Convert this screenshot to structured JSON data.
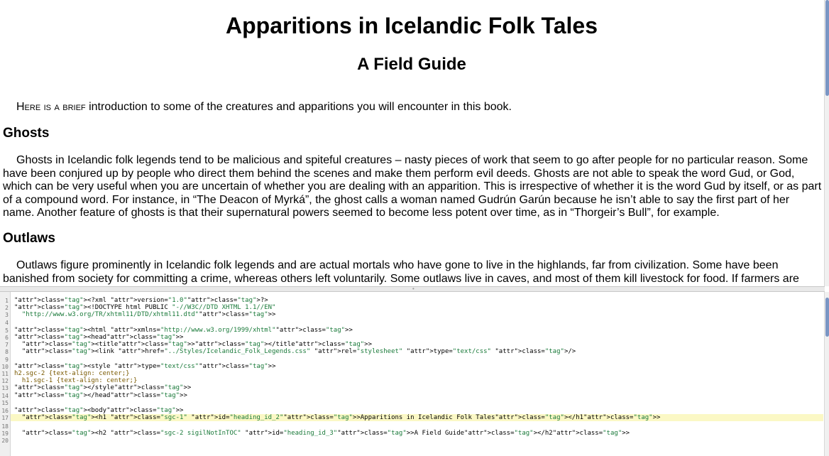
{
  "preview": {
    "title": "Apparitions in Icelandic Folk Tales",
    "subtitle": "A Field Guide",
    "intro_smallcaps": "Here is a brief",
    "intro_rest": " introduction to some of the creatures and apparitions you will encounter in this book.",
    "sections": [
      {
        "heading": "Ghosts",
        "text": "Ghosts in Icelandic folk legends tend to be malicious and spiteful creatures – nasty pieces of work that seem to go after people for no particular reason. Some have been conjured up by people who direct them behind the scenes and make them perform evil deeds. Ghosts are not able to speak the word Gud, or God, which can be very useful when you are uncertain of whether you are dealing with an apparition. This is irrespective of whether it is the word Gud by itself, or as part of a compound word. For instance, in “The Deacon of Myrká”, the ghost calls a woman named Gudrún Garún because he isn’t able to say the first part of her name. Another feature of ghosts is that their supernatural powers seemed to become less potent over time, as in “Thorgeir’s Bull”, for example."
      },
      {
        "heading": "Outlaws",
        "text": "Outlaws figure prominently in Icelandic folk legends and are actual mortals who have gone to live in the highlands, far from civilization. Some have been banished from society for committing a crime, whereas others left voluntarily. Some outlaws live in caves, and most of them kill livestock for food. If farmers are"
      }
    ]
  },
  "code": {
    "line_numbers": [
      "1",
      "2",
      "3",
      "4",
      "5",
      "6",
      "7",
      "8",
      "9",
      "10",
      "11",
      "12",
      "13",
      "14",
      "15",
      "16",
      "17",
      "18",
      "19",
      "20"
    ],
    "lines": [
      {
        "n": "1",
        "t": "<?xml version=\"1.0\"?>"
      },
      {
        "n": "2",
        "t": "<!DOCTYPE html PUBLIC \"-//W3C//DTD XHTML 1.1//EN\""
      },
      {
        "n": "3",
        "t": "  \"http://www.w3.org/TR/xhtml11/DTD/xhtml11.dtd\">"
      },
      {
        "n": "4",
        "t": ""
      },
      {
        "n": "5",
        "t": "<html xmlns=\"http://www.w3.org/1999/xhtml\">"
      },
      {
        "n": "6",
        "t": "<head>"
      },
      {
        "n": "7",
        "t": "  <title></title>"
      },
      {
        "n": "8",
        "t": "  <link href=\"../Styles/Icelandic_Folk_Legends.css\" rel=\"stylesheet\" type=\"text/css\" />"
      },
      {
        "n": "9",
        "t": ""
      },
      {
        "n": "10",
        "t": "<style type=\"text/css\">"
      },
      {
        "n": "11",
        "t": "h2.sgc-2 {text-align: center;}"
      },
      {
        "n": "12",
        "t": "  h1.sgc-1 {text-align: center;}"
      },
      {
        "n": "13",
        "t": "</style>"
      },
      {
        "n": "14",
        "t": "</head>"
      },
      {
        "n": "15",
        "t": ""
      },
      {
        "n": "16",
        "t": "<body>"
      },
      {
        "n": "17",
        "t": "  <h1 class=\"sgc-1\" id=\"heading_id_2\">Apparitions in Icelandic Folk Tales</h1>"
      },
      {
        "n": "18",
        "t": ""
      },
      {
        "n": "19",
        "t": "  <h2 class=\"sgc-2 sigilNotInTOC\" id=\"heading_id_3\">A Field Guide</h2>"
      },
      {
        "n": "20",
        "t": ""
      }
    ]
  }
}
